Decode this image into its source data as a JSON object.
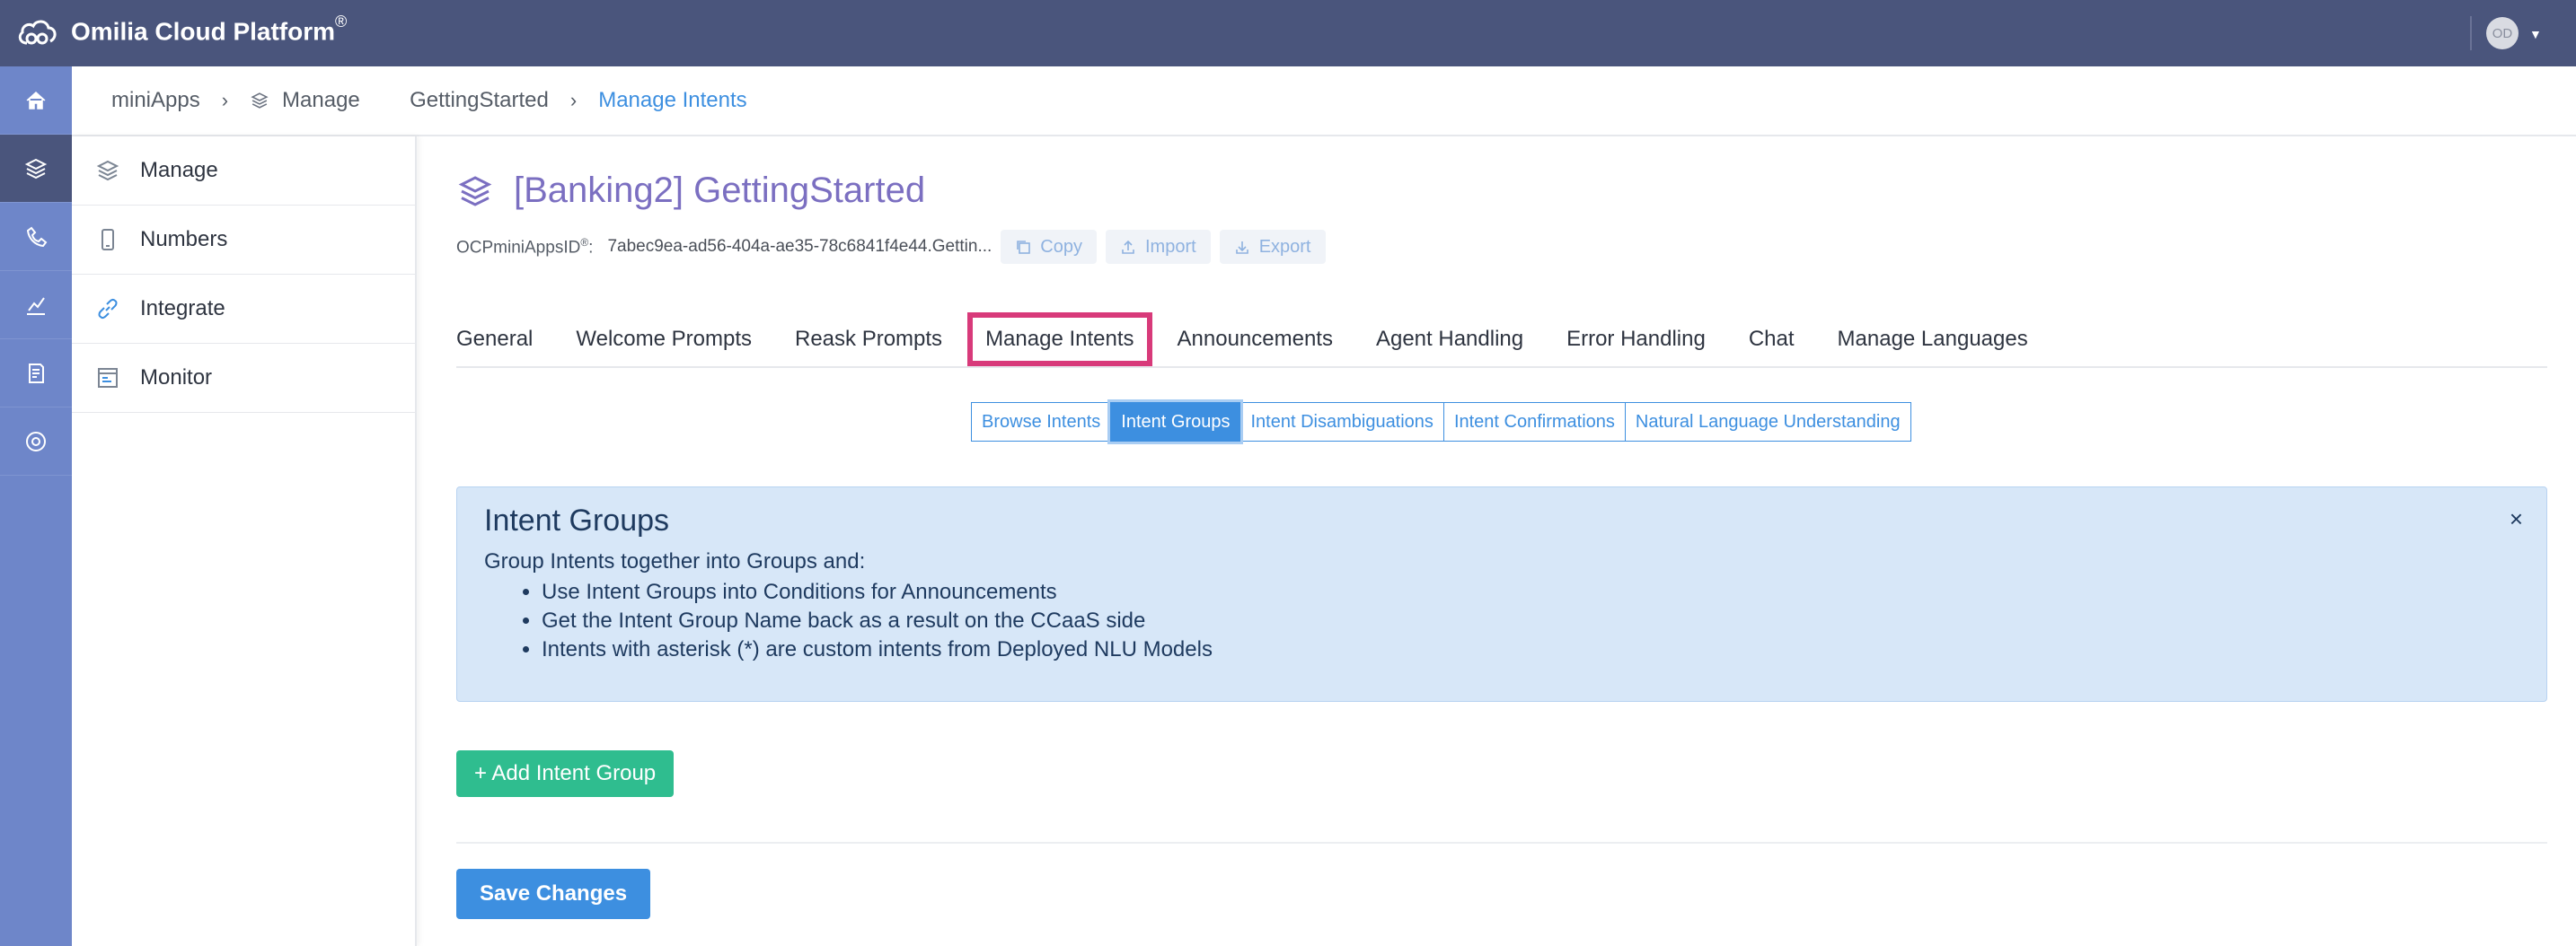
{
  "header": {
    "app_title": "Omilia Cloud Platform",
    "trademark": "®",
    "avatar_initials": "OD",
    "logo_icon": "cloud-icon"
  },
  "rail": {
    "items": [
      {
        "name": "home",
        "icon": "home-icon",
        "active": false
      },
      {
        "name": "manage",
        "icon": "layers-icon",
        "active": true
      },
      {
        "name": "numbers",
        "icon": "phone-icon",
        "active": false
      },
      {
        "name": "analytics",
        "icon": "chart-icon",
        "active": false
      },
      {
        "name": "billing",
        "icon": "invoice-icon",
        "active": false
      },
      {
        "name": "global",
        "icon": "globe-icon",
        "active": false
      }
    ]
  },
  "breadcrumb": {
    "items": [
      "miniApps",
      "Manage",
      "GettingStarted",
      "Manage Intents"
    ]
  },
  "sidebar": {
    "items": [
      {
        "label": "Manage",
        "icon": "layers-icon"
      },
      {
        "label": "Numbers",
        "icon": "phone-icon"
      },
      {
        "label": "Integrate",
        "icon": "link-icon"
      },
      {
        "label": "Monitor",
        "icon": "monitor-icon"
      }
    ]
  },
  "main": {
    "title": "[Banking2] GettingStarted",
    "id_label": "OCPminiAppsID",
    "id_trademark": "®",
    "id_suffix": ":",
    "id_value": "7abec9ea-ad56-404a-ae35-78c6841f4e44.Gettin...",
    "copy_label": "Copy",
    "import_label": "Import",
    "export_label": "Export",
    "tabs": [
      "General",
      "Welcome Prompts",
      "Reask Prompts",
      "Manage Intents",
      "Announcements",
      "Agent Handling",
      "Error Handling",
      "Chat",
      "Manage Languages"
    ],
    "active_tab": "Manage Intents",
    "subtabs": [
      "Browse Intents",
      "Intent Groups",
      "Intent Disambiguations",
      "Intent Confirmations",
      "Natural Language Understanding"
    ],
    "active_subtab": "Intent Groups",
    "info": {
      "title": "Intent Groups",
      "intro": "Group Intents together into Groups and:",
      "bullets": [
        "Use Intent Groups into Conditions for Announcements",
        "Get the Intent Group Name back as a result on the CCaaS side",
        "Intents with asterisk (*) are custom intents from Deployed NLU Models"
      ],
      "close": "×"
    },
    "add_button": "+ Add Intent Group",
    "save_button": "Save Changes"
  },
  "colors": {
    "topbar": "#4a557c",
    "rail": "#6e86c9",
    "accent": "#3d8fe0",
    "title": "#7b6fc1",
    "highlight": "#d83a7a",
    "add_button": "#2fbd8f",
    "info_bg": "#d7e7f8"
  }
}
